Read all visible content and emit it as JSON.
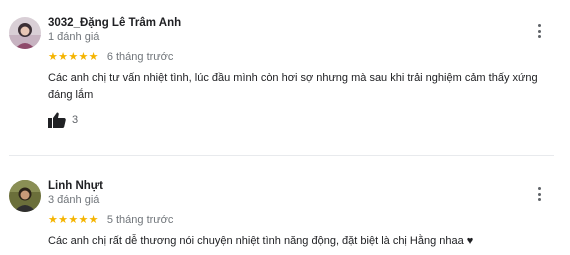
{
  "reviews": [
    {
      "name": "3032_Đặng Lê Trâm Anh",
      "review_count": "1 đánh giá",
      "stars": "★★★★★",
      "rating": 5,
      "time": "6 tháng trước",
      "text": "Các anh chị tư vấn nhiệt tình, lúc đầu mình còn hơi sợ nhưng mà sau khi trải nghiệm cảm thấy xứng đáng lắm",
      "likes": "3"
    },
    {
      "name": "Linh Nhựt",
      "review_count": "3 đánh giá",
      "stars": "★★★★★",
      "rating": 5,
      "time": "5 tháng trước",
      "text": "Các anh chị rất dễ thương nói chuyện nhiệt tình năng động, đặt biệt là chị Hằng nhaa ♥"
    }
  ],
  "colors": {
    "star": "#f5b400",
    "secondary_text": "#70757a",
    "divider": "#e8eaed"
  },
  "icons": [
    "more-vert-icon",
    "thumb-up-icon"
  ]
}
